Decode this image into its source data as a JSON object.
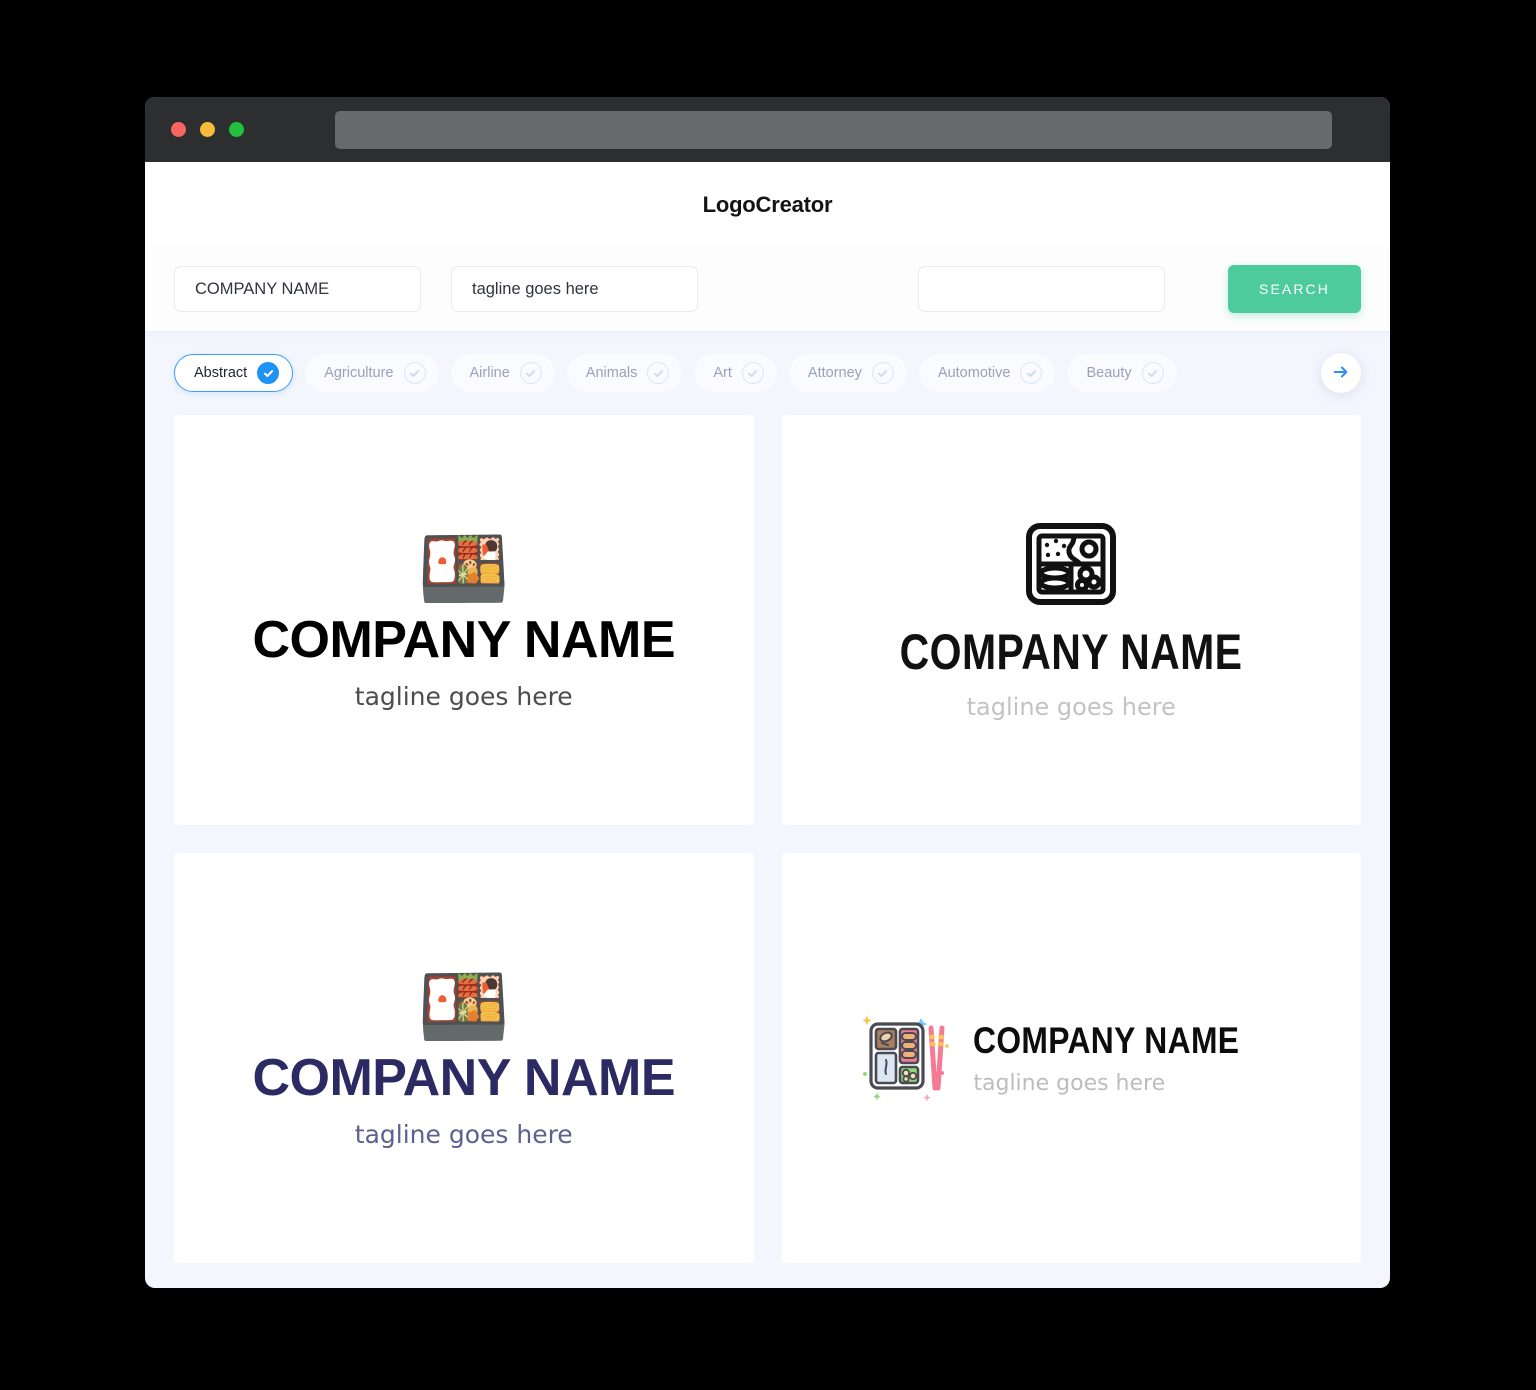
{
  "window": {
    "traffic_lights": [
      {
        "name": "close",
        "color": "#f9655e"
      },
      {
        "name": "minimize",
        "color": "#f7bb3a"
      },
      {
        "name": "maximize",
        "color": "#22c03c"
      }
    ],
    "url_value": ""
  },
  "header": {
    "app_title": "LogoCreator"
  },
  "search": {
    "company_value": "COMPANY NAME",
    "company_placeholder": "COMPANY NAME",
    "tagline_value": "tagline goes here",
    "tagline_placeholder": "tagline goes here",
    "extra_value": "",
    "extra_placeholder": "",
    "search_label": "SEARCH",
    "search_color": "#4ecb9d"
  },
  "categories": {
    "active_index": 0,
    "accent_color": "#1f93f5",
    "items": [
      {
        "label": "Abstract",
        "selected": true
      },
      {
        "label": "Agriculture",
        "selected": false
      },
      {
        "label": "Airline",
        "selected": false
      },
      {
        "label": "Animals",
        "selected": false
      },
      {
        "label": "Art",
        "selected": false
      },
      {
        "label": "Attorney",
        "selected": false
      },
      {
        "label": "Automotive",
        "selected": false
      },
      {
        "label": "Beauty",
        "selected": false
      }
    ],
    "next_icon": "arrow-right-icon"
  },
  "logos": [
    {
      "id": "logo-card-1",
      "icon": "bento-box-emoji",
      "emoji": "🍱",
      "name": "COMPANY NAME",
      "tagline": "tagline goes here",
      "name_color": "#000000",
      "tagline_color": "#4d4d4d",
      "layout": "stacked"
    },
    {
      "id": "logo-card-2",
      "icon": "bento-box-line-icon",
      "name": "COMPANY NAME",
      "tagline": "tagline goes here",
      "name_color": "#111111",
      "tagline_color": "#c3c3c3",
      "layout": "stacked"
    },
    {
      "id": "logo-card-3",
      "icon": "bento-box-chopsticks-emoji",
      "emoji": "🍱",
      "name": "COMPANY NAME",
      "tagline": "tagline goes here",
      "name_color": "#2b2a62",
      "tagline_color": "#5f6090",
      "layout": "stacked"
    },
    {
      "id": "logo-card-4",
      "icon": "bento-box-chopsticks-color-icon",
      "name": "COMPANY NAME",
      "tagline": "tagline goes here",
      "name_color": "#0d0d0d",
      "tagline_color": "#bdbdbd",
      "layout": "horizontal"
    }
  ]
}
